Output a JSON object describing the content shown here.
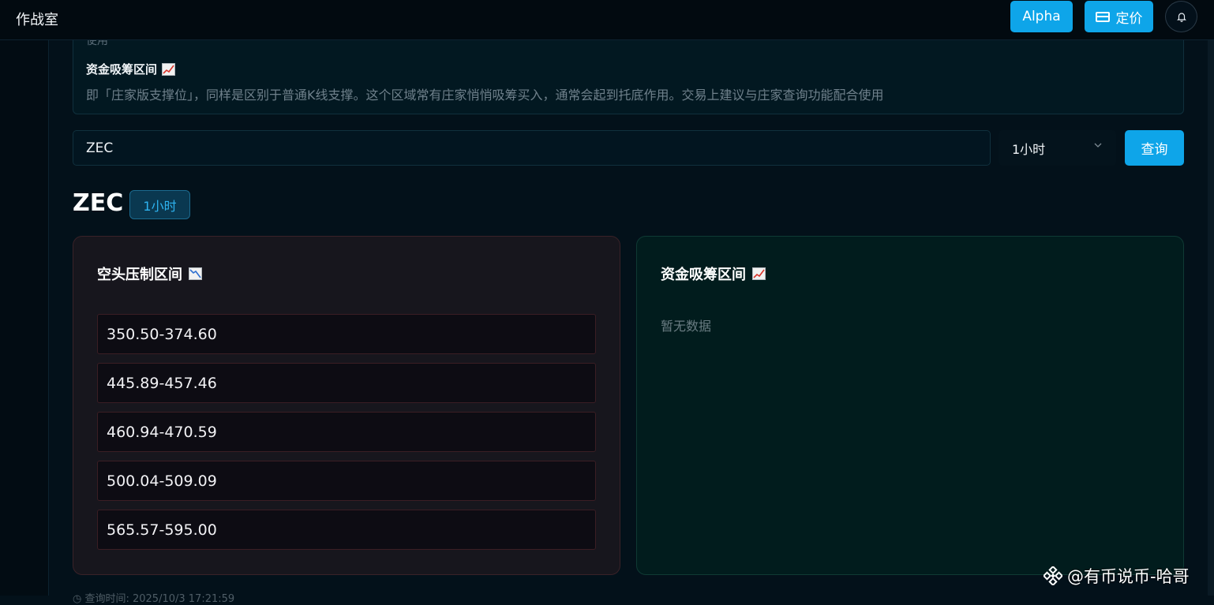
{
  "header": {
    "app_title": "作战室",
    "alpha_label": "Alpha",
    "pricing_label": "定价"
  },
  "info": {
    "prev_text": "使用",
    "heading": "资金吸筹区间",
    "description": "即「庄家版支撑位」，同样是区别于普通K线支撑。这个区域常有庄家悄悄吸筹买入，通常会起到托底作用。交易上建议与庄家查询功能配合使用"
  },
  "search": {
    "value": "ZEC",
    "interval_selected": "1小时",
    "query_label": "查询"
  },
  "result": {
    "symbol": "ZEC",
    "interval_badge": "1小时",
    "bear_card": {
      "heading": "空头压制区间",
      "zones": [
        "350.50-374.60",
        "445.89-457.46",
        "460.94-470.59",
        "500.04-509.09",
        "565.57-595.00"
      ]
    },
    "bull_card": {
      "heading": "资金吸筹区间",
      "empty_text": "暂无数据"
    },
    "query_time": "◷ 查询时间: 2025/10/3 17:21:59"
  },
  "watermark": {
    "text": "@有币说币-哈哥"
  },
  "colors": {
    "accent": "#0ea5e9",
    "bear_border": "#3a2228",
    "bull_bg": "#011c1d"
  }
}
